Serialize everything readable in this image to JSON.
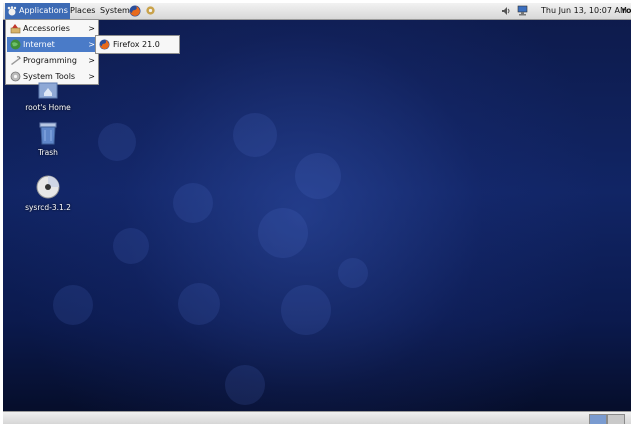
{
  "top_panel": {
    "applications": "Applications",
    "places": "Places",
    "system": "System",
    "launchers": [
      "firefox-icon",
      "settings-icon"
    ],
    "tray_icons": [
      "volume-icon",
      "network-icon"
    ],
    "clock": "Thu Jun 13, 10:07 AM",
    "user": "root"
  },
  "app_menu": {
    "items": [
      {
        "label": "Accessories",
        "icon": "accessories-icon"
      },
      {
        "label": "Internet",
        "icon": "internet-icon"
      },
      {
        "label": "Programming",
        "icon": "programming-icon"
      },
      {
        "label": "System Tools",
        "icon": "system-tools-icon"
      }
    ],
    "arrow": ">",
    "selected": "Internet"
  },
  "internet_submenu": {
    "items": [
      {
        "label": "Firefox 21.0",
        "icon": "firefox-icon"
      }
    ]
  },
  "desktop": {
    "icons": [
      {
        "label": "root's Home",
        "icon": "home-folder-icon"
      },
      {
        "label": "Trash",
        "icon": "trash-icon"
      },
      {
        "label": "sysrcd-3.1.2",
        "icon": "disc-icon"
      }
    ]
  },
  "bottom_panel": {
    "workspaces": 2,
    "active_workspace": 1
  },
  "colors": {
    "menu_highlight": "#4a7bc8",
    "desktop_background": "#112565"
  }
}
